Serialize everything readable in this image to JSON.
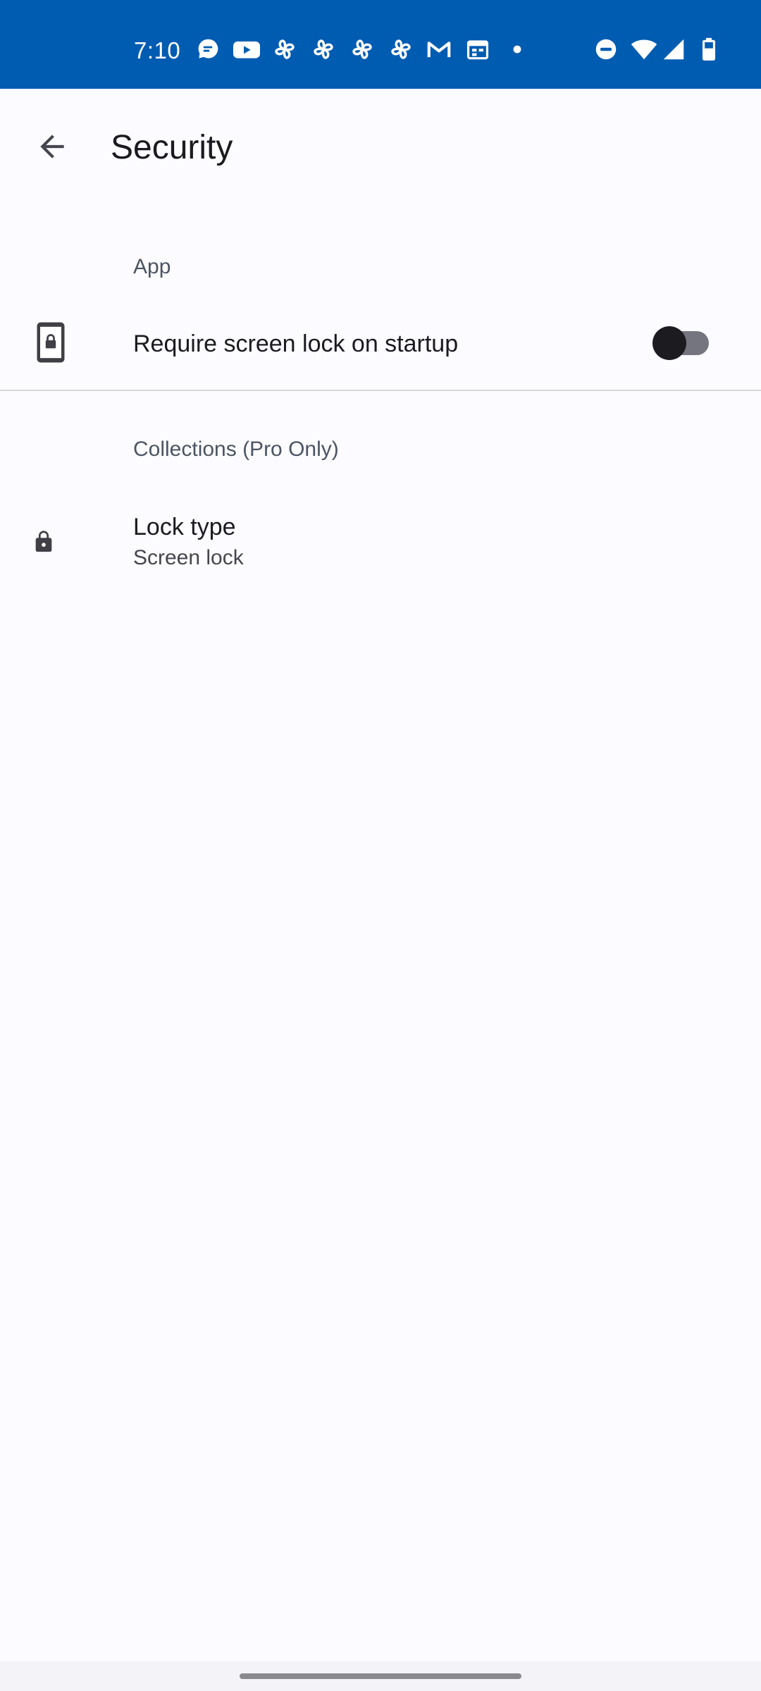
{
  "status_bar": {
    "time": "7:10",
    "background_color": "#005cb1",
    "left_icons": [
      "chat-icon",
      "youtube-icon",
      "pinwheel-icon",
      "pinwheel-icon",
      "pinwheel-icon",
      "pinwheel-icon",
      "gmail-icon",
      "calendar-icon",
      "dot-icon"
    ],
    "right_icons": [
      "do-not-disturb-icon",
      "wifi-icon",
      "cellular-signal-icon",
      "battery-icon"
    ]
  },
  "header": {
    "title": "Security",
    "back_icon": "arrow-back-icon"
  },
  "sections": [
    {
      "header": "App",
      "items": [
        {
          "icon": "phone-lock-icon",
          "title": "Require screen lock on startup",
          "toggle_state": "off"
        }
      ]
    },
    {
      "header": "Collections (Pro Only)",
      "items": [
        {
          "icon": "lock-icon",
          "title": "Lock type",
          "summary": "Screen lock"
        }
      ]
    }
  ]
}
